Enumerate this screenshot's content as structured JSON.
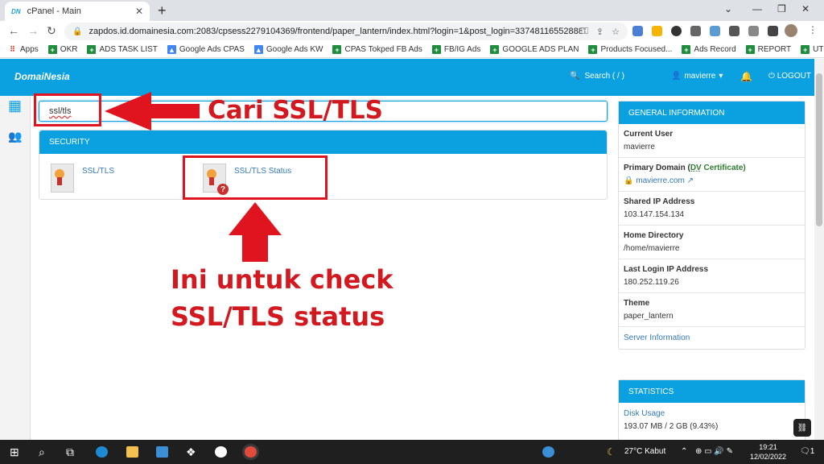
{
  "browser": {
    "tab_title": "cPanel - Main",
    "tab_favicon": "DN",
    "url": "zapdos.id.domainesia.com:2083/cpsess2279104369/frontend/paper_lantern/index.html?login=1&post_login=33748116552888",
    "bookmarks": [
      "Apps",
      "OKR",
      "ADS TASK LIST",
      "Google Ads CPAS",
      "Google Ads KW",
      "CPAS Tokped FB Ads",
      "FB/IG Ads",
      "GOOGLE ADS PLAN",
      "Products Focused...",
      "Ads Record",
      "REPORT",
      "UTM"
    ]
  },
  "header": {
    "logo": "DomaiNesia",
    "search": "Search ( / )",
    "user": "mavierre",
    "logout": "LOGOUT"
  },
  "search": {
    "value": "ssl/tls"
  },
  "security": {
    "title": "SECURITY",
    "items": [
      "SSL/TLS",
      "SSL/TLS Status"
    ]
  },
  "general_info": {
    "title": "GENERAL INFORMATION",
    "current_user_label": "Current User",
    "current_user": "mavierre",
    "primary_domain_label": "Primary Domain (",
    "dv": "DV",
    "certificate": " Certificate)",
    "primary_domain": "mavierre.com",
    "shared_ip_label": "Shared IP Address",
    "shared_ip": "103.147.154.134",
    "home_dir_label": "Home Directory",
    "home_dir": "/home/mavierre",
    "last_login_label": "Last Login IP Address",
    "last_login": "180.252.119.26",
    "theme_label": "Theme",
    "theme": "paper_lantern",
    "server_info": "Server Information"
  },
  "statistics": {
    "title": "STATISTICS",
    "disk_usage_label": "Disk Usage",
    "disk_usage": "193.07 MB / 2 GB  (9.43%)"
  },
  "annotations": {
    "search_hint": "Cari SSL/TLS",
    "status_hint_1": "Ini untuk check",
    "status_hint_2": "SSL/TLS status"
  },
  "taskbar": {
    "weather": "27°C  Kabut",
    "time": "19:21",
    "date": "12/02/2022",
    "notifications": "1"
  },
  "colors": {
    "cpanel_blue": "#0ba1e1",
    "annotation_red": "#e0141e"
  }
}
